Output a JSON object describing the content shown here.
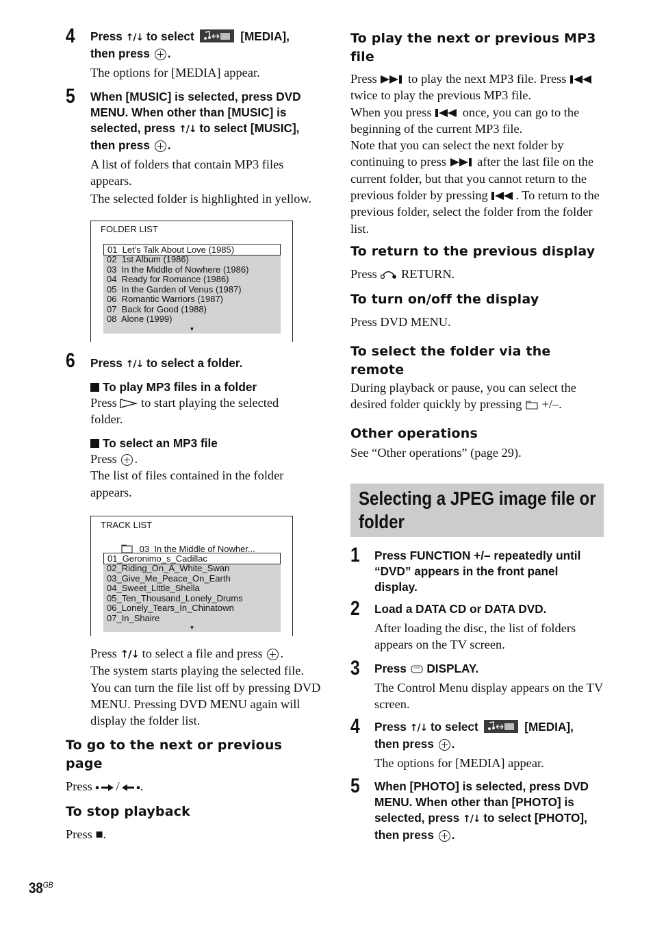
{
  "page": {
    "number": "38",
    "suffix": "GB"
  },
  "left": {
    "step4": {
      "num": "4",
      "title_a": "Press ",
      "title_b": " to select ",
      "title_c": " [MEDIA],",
      "title_d": "then press ",
      "title_e": ".",
      "body": "The options for [MEDIA] appear."
    },
    "step5": {
      "num": "5",
      "title_a": "When [MUSIC] is selected, press DVD MENU. When other than [MUSIC] is selected, press ",
      "title_b": " to select [MUSIC], then press ",
      "title_c": ".",
      "body1": "A list of folders that contain MP3 files appears.",
      "body2": "The selected folder is highlighted in yellow."
    },
    "folder_list": {
      "title": "FOLDER LIST",
      "rows": [
        "01  Let's Talk About Love (1985)",
        "02  1st Album (1986)",
        "03  In the Middle of Nowhere (1986)",
        "04  Ready for Romance (1986)",
        "05  In the Garden of Venus (1987)",
        "06  Romantic Warriors (1987)",
        "07  Back for Good (1988)",
        "08  Alone (1999)"
      ],
      "selected_index": 0,
      "more": "▼"
    },
    "step6": {
      "num": "6",
      "title_a": "Press ",
      "title_b": " to select a folder."
    },
    "play_mp3": {
      "heading": "To play MP3 files in a folder",
      "body_a": "Press ",
      "body_b": " to start playing the selected folder."
    },
    "select_mp3": {
      "heading": "To select an MP3 file",
      "body_a": "Press ",
      "body_b": ".",
      "body2": "The list of files contained in the folder appears."
    },
    "track_list": {
      "title": "TRACK LIST",
      "folder": "03  In the Middle of Nowher...",
      "rows": [
        "01_Geronimo_s_Cadillac",
        "02_Riding_On_A_White_Swan",
        "03_Give_Me_Peace_On_Earth",
        "04_Sweet_Little_Shella",
        "05_Ten_Thousand_Lonely_Drums",
        "06_Lonely_Tears_In_Chinatown",
        "07_In_Shaire"
      ],
      "selected_index": 0,
      "more": "▼"
    },
    "after_track": {
      "line1_a": "Press ",
      "line1_b": " to select a file and press ",
      "line1_c": ".",
      "rest": "The system starts playing the selected file. You can turn the file list off by pressing DVD MENU. Pressing DVD MENU again will display the folder list."
    },
    "next_page": {
      "heading": "To go to the next or previous page",
      "body_a": "Press ",
      "body_sep": "/",
      "body_b": "."
    },
    "stop": {
      "heading": "To stop playback",
      "body_a": "Press ",
      "body_b": "."
    }
  },
  "right": {
    "next_prev_mp3": {
      "heading": "To play the next or previous MP3 file",
      "p1_a": "Press ",
      "p1_b": " to play the next MP3 file. Press ",
      "p1_c": " twice to play the previous MP3 file.",
      "p2_a": "When you press ",
      "p2_b": " once, you can go to the beginning of the current MP3 file.",
      "p3_a": "Note that you can select the next folder by continuing to press ",
      "p3_b": " after the last file on the current folder, but that you cannot return to the previous folder by pressing ",
      "p3_c": ". To return to the previous folder, select the folder from the folder list."
    },
    "return": {
      "heading": "To return to the previous display",
      "body_a": "Press ",
      "body_b": " RETURN."
    },
    "display": {
      "heading": "To turn on/off the display",
      "body": "Press DVD MENU."
    },
    "folder_remote": {
      "heading": "To select the folder via the remote",
      "body_a": "During playback or pause, you can select the desired folder quickly by pressing ",
      "body_b": " +/–."
    },
    "other": {
      "heading": "Other operations",
      "body": "See “Other operations” (page 29)."
    },
    "banner": {
      "title": "Selecting a JPEG image file or folder"
    },
    "step1": {
      "num": "1",
      "title": "Press FUNCTION +/– repeatedly until “DVD” appears in the front panel display."
    },
    "step2": {
      "num": "2",
      "title": "Load a DATA CD or DATA DVD.",
      "body": "After loading the disc, the list of folders appears on the TV screen."
    },
    "step3": {
      "num": "3",
      "title_a": "Press ",
      "title_b": " DISPLAY.",
      "body": "The Control Menu display appears on the TV screen."
    },
    "step4": {
      "num": "4",
      "title_a": "Press ",
      "title_b": " to select ",
      "title_c": " [MEDIA],",
      "title_d": "then press ",
      "title_e": ".",
      "body": "The options for [MEDIA] appear."
    },
    "step5": {
      "num": "5",
      "title_a": "When [PHOTO] is selected, press DVD MENU. When other than [PHOTO] is selected, press ",
      "title_b": " to select [PHOTO], then press ",
      "title_c": "."
    }
  },
  "icons": {
    "up_down": "↑/↓",
    "stop": "■",
    "more": "▼"
  }
}
